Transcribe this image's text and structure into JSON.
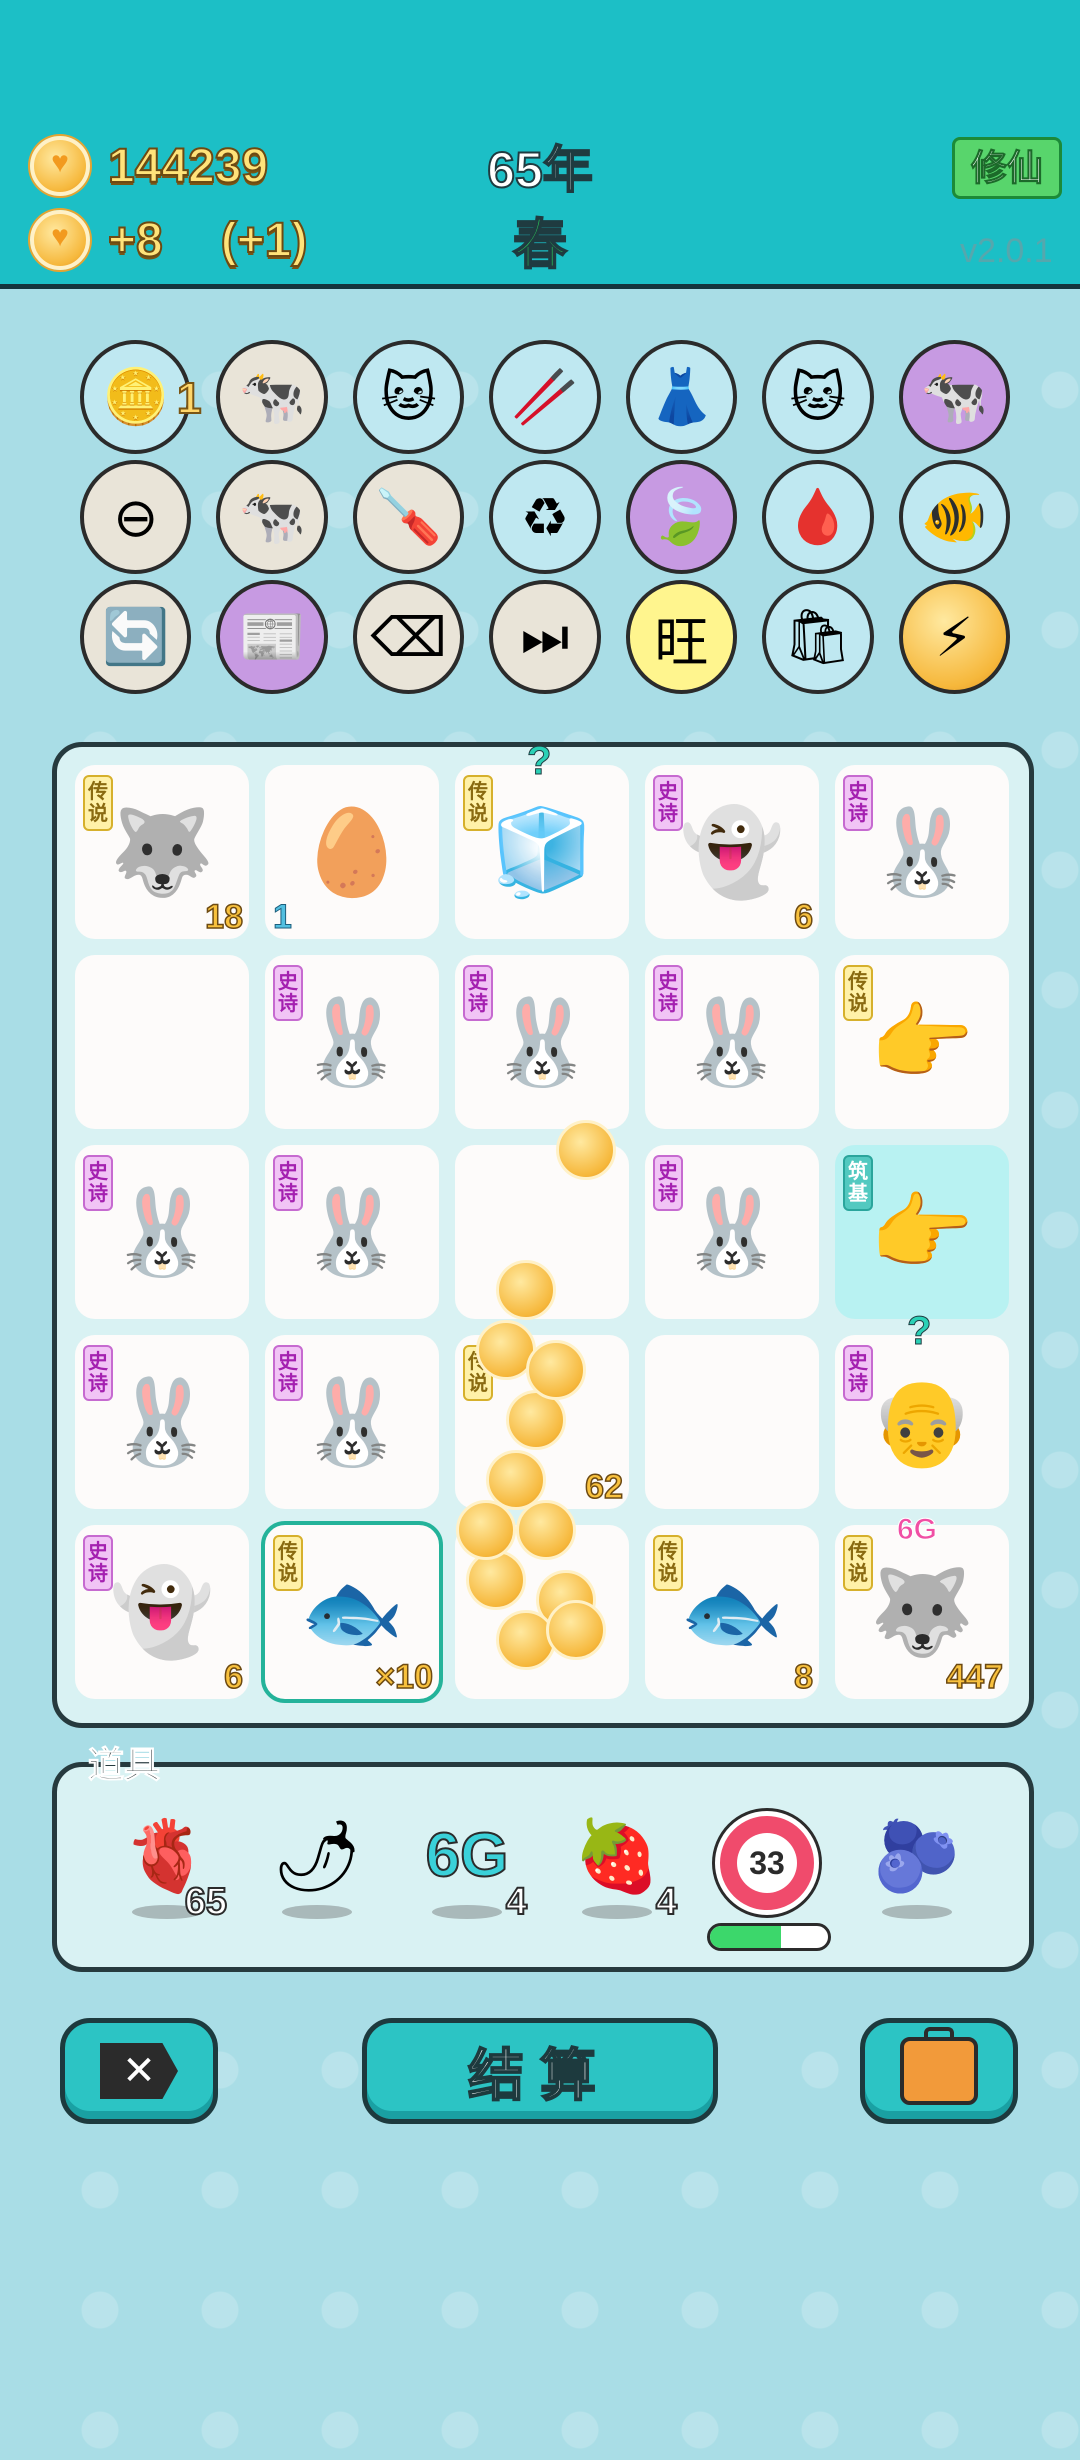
{
  "header": {
    "coins_total": "144239",
    "coins_rate": "+8",
    "coins_bonus": "(+1)",
    "year": "65年",
    "season": "春",
    "xiuxian_button": "修仙",
    "version": "v2.0.1"
  },
  "skills": {
    "row1": [
      {
        "name": "coin-heart-icon",
        "icon": "🪙",
        "count": "1",
        "bg": "blue"
      },
      {
        "name": "cow-pair-icon",
        "icon": "🐄",
        "bg": ""
      },
      {
        "name": "cat-icon",
        "icon": "🐱",
        "bg": "blue"
      },
      {
        "name": "chopsticks-icon",
        "icon": "🥢",
        "bg": "blue"
      },
      {
        "name": "skirt-icon",
        "icon": "👗",
        "bg": "blue"
      },
      {
        "name": "cat-icon",
        "icon": "🐱",
        "bg": "blue"
      },
      {
        "name": "cow-pair-icon",
        "icon": "🐄",
        "bg": "purple"
      }
    ],
    "row2": [
      {
        "name": "minus-circle-icon",
        "icon": "⊖",
        "bg": ""
      },
      {
        "name": "cow-pair-icon",
        "icon": "🐄",
        "bg": ""
      },
      {
        "name": "screwdriver-icon",
        "icon": "🪛",
        "bg": ""
      },
      {
        "name": "trash-bag-recycle-icon",
        "icon": "♻",
        "bg": "blue"
      },
      {
        "name": "leaf-icon",
        "icon": "🍃",
        "bg": "purple"
      },
      {
        "name": "blood-bag-icon",
        "icon": "🩸",
        "bg": "blue"
      },
      {
        "name": "fish-tank-icon",
        "icon": "🐠",
        "bg": "blue"
      }
    ],
    "row3": [
      {
        "name": "refresh-icon",
        "icon": "🔄",
        "bg": ""
      },
      {
        "name": "time-magazine-icon",
        "icon": "📰",
        "bg": "purple"
      },
      {
        "name": "delete-key-icon",
        "icon": "⌫",
        "bg": ""
      },
      {
        "name": "skip-icon",
        "icon": "⏭",
        "bg": ""
      },
      {
        "name": "wang-text-icon",
        "icon": "旺",
        "bg": "yellow"
      },
      {
        "name": "trash-bag-minus-icon",
        "icon": "🛍",
        "bg": "blue"
      },
      {
        "name": "lightning-icon",
        "icon": "⚡",
        "bg": "gold"
      }
    ]
  },
  "board": {
    "cells": [
      {
        "name": "husky-king",
        "icon": "🐺",
        "tag": "传说",
        "tagc": "y",
        "num": "18"
      },
      {
        "name": "egg",
        "icon": "🥚",
        "tag": "",
        "tagc": "",
        "num": "1",
        "numpos": "l"
      },
      {
        "name": "fridge",
        "icon": "🧊",
        "tag": "传说",
        "tagc": "y",
        "num": "",
        "q": "?"
      },
      {
        "name": "ghost",
        "icon": "👻",
        "tag": "史诗",
        "tagc": "p",
        "num": "6"
      },
      {
        "name": "rabbit-house",
        "icon": "🐰",
        "tag": "史诗",
        "tagc": "p",
        "num": ""
      },
      {
        "name": "empty",
        "icon": "",
        "tag": "",
        "tagc": "",
        "num": ""
      },
      {
        "name": "rabbit-house",
        "icon": "🐰",
        "tag": "史诗",
        "tagc": "p",
        "num": ""
      },
      {
        "name": "rabbit-house",
        "icon": "🐰",
        "tag": "史诗",
        "tagc": "p",
        "num": ""
      },
      {
        "name": "rabbit-house-king",
        "icon": "🐰",
        "tag": "史诗",
        "tagc": "p",
        "num": ""
      },
      {
        "name": "pointing-hand",
        "icon": "👉",
        "tag": "传说",
        "tagc": "y",
        "num": ""
      },
      {
        "name": "rabbit-house",
        "icon": "🐰",
        "tag": "史诗",
        "tagc": "p",
        "num": ""
      },
      {
        "name": "rabbit-house",
        "icon": "🐰",
        "tag": "史诗",
        "tagc": "p",
        "num": ""
      },
      {
        "name": "empty",
        "icon": "",
        "tag": "",
        "tagc": "",
        "num": ""
      },
      {
        "name": "rabbit-house",
        "icon": "🐰",
        "tag": "史诗",
        "tagc": "p",
        "num": ""
      },
      {
        "name": "pointing-hand",
        "icon": "👉",
        "tag": "筑基",
        "tagc": "t",
        "num": "",
        "teal": true
      },
      {
        "name": "rabbit-house",
        "icon": "🐰",
        "tag": "史诗",
        "tagc": "p",
        "num": ""
      },
      {
        "name": "rabbit-house",
        "icon": "🐰",
        "tag": "史诗",
        "tagc": "p",
        "num": ""
      },
      {
        "name": "coin-item",
        "icon": "",
        "tag": "传说",
        "tagc": "y",
        "num": "62"
      },
      {
        "name": "empty",
        "icon": "",
        "tag": "",
        "tagc": "",
        "num": ""
      },
      {
        "name": "old-man",
        "icon": "👴",
        "tag": "史诗",
        "tagc": "p",
        "num": "",
        "q": "?"
      },
      {
        "name": "ghost",
        "icon": "👻",
        "tag": "史诗",
        "tagc": "p",
        "num": "6"
      },
      {
        "name": "koi-fish",
        "icon": "🐟",
        "tag": "传说",
        "tagc": "y",
        "num": "×10",
        "sel": true
      },
      {
        "name": "coin-burst",
        "icon": "",
        "tag": "",
        "tagc": "",
        "num": ""
      },
      {
        "name": "koi-fish",
        "icon": "🐟",
        "tag": "传说",
        "tagc": "y",
        "num": "8"
      },
      {
        "name": "husky-king",
        "icon": "🐺",
        "tag": "传说",
        "tagc": "y",
        "num": "447",
        "sixg": "6G"
      }
    ]
  },
  "props": {
    "title": "道具",
    "items": [
      {
        "name": "liver-icon",
        "icon": "🫀",
        "count": "65"
      },
      {
        "name": "chili-icon",
        "icon": "🌶",
        "count": ""
      },
      {
        "name": "6g-icon",
        "text": "6G",
        "count": "4"
      },
      {
        "name": "lychee-icon",
        "icon": "🍓",
        "count": "4"
      },
      {
        "name": "target-icon",
        "target": "33",
        "progress": 0.6,
        "count": ""
      },
      {
        "name": "blueberry-icon",
        "icon": "🫐",
        "count": ""
      }
    ]
  },
  "buttons": {
    "settle": "结算"
  },
  "colors": {
    "header_bg": "#1cbfc6",
    "page_bg": "#a9dde6",
    "accent_teal": "#2cc4c4"
  }
}
